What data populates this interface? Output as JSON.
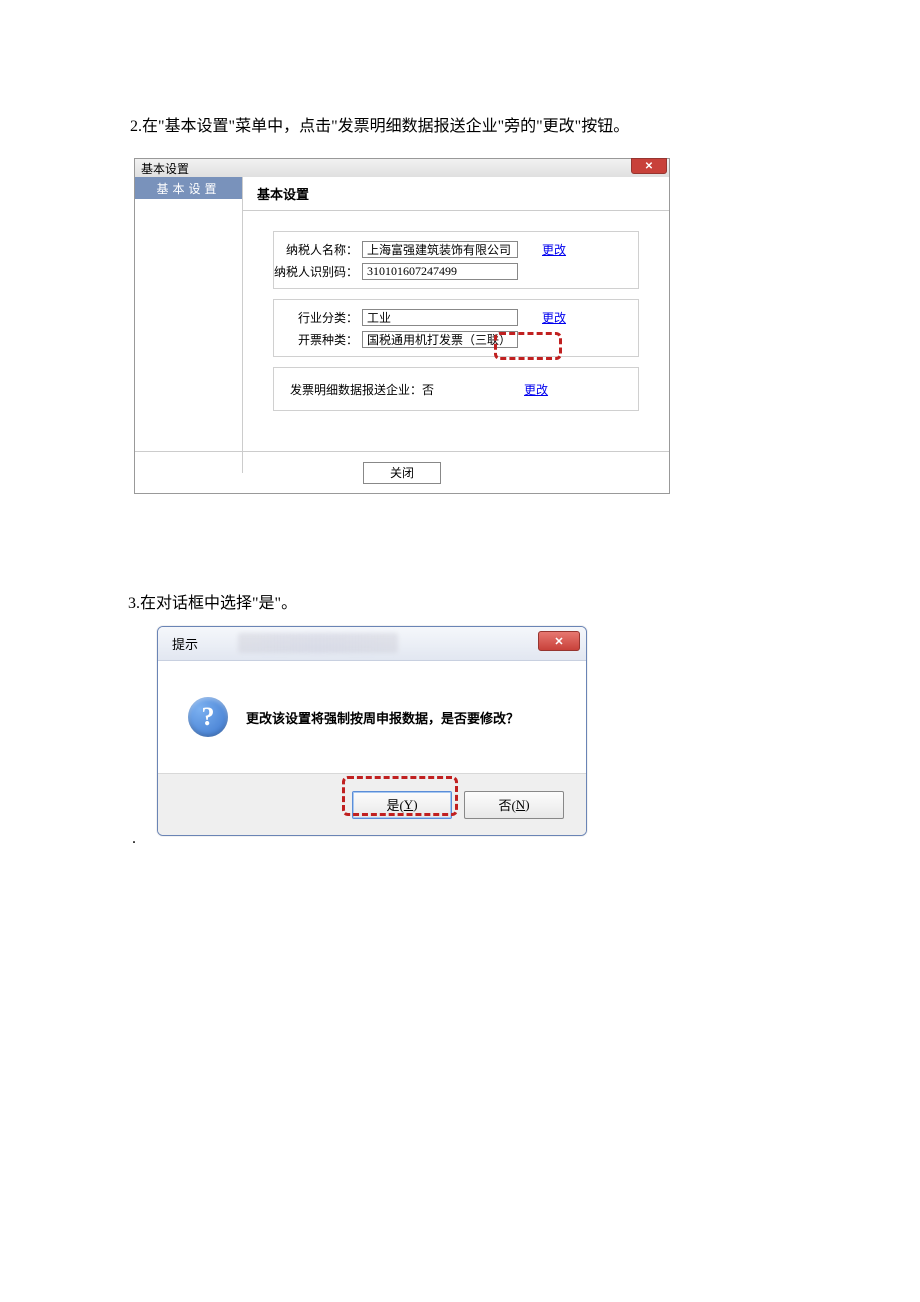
{
  "instruction1": "2.在\"基本设置\"菜单中，点击\"发票明细数据报送企业\"旁的\"更改\"按钮。",
  "instruction2": "3.在对话框中选择\"是\"。",
  "dialog1": {
    "title": "基本设置",
    "sidebar_item": "基本设置",
    "main_header": "基本设置",
    "row1_label": "纳税人名称：",
    "row1_value": "上海富强建筑装饰有限公司",
    "row1_link": "更改",
    "row2_label": "纳税人识别码：",
    "row2_value": "310101607247499",
    "row3_label": "行业分类：",
    "row3_value": "工业",
    "row3_link": "更改",
    "row4_label": "开票种类：",
    "row4_value": "国税通用机打发票（三联）",
    "row5_text": "发票明细数据报送企业：否",
    "row5_link": "更改",
    "close_btn": "关闭"
  },
  "dialog2": {
    "title": "提示",
    "message": "更改该设置将强制按周申报数据，是否要修改？",
    "yes_btn_prefix": "是(",
    "yes_btn_key": "Y",
    "yes_btn_suffix": ")",
    "no_btn_prefix": "否(",
    "no_btn_key": "N",
    "no_btn_suffix": ")"
  }
}
